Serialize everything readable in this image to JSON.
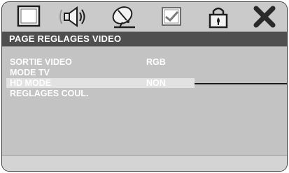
{
  "tabs": [
    {
      "icon": "tv-screen-icon",
      "selected": false
    },
    {
      "icon": "speaker-audio-icon",
      "selected": false
    },
    {
      "icon": "satellite-dish-icon",
      "selected": true
    },
    {
      "icon": "checkbox-preferences-icon",
      "selected": false
    },
    {
      "icon": "padlock-icon",
      "selected": false
    },
    {
      "icon": "close-x-icon",
      "selected": false
    }
  ],
  "title": "PAGE REGLAGES VIDEO",
  "menu": [
    {
      "label": "SORTIE VIDEO",
      "value": "RGB"
    },
    {
      "label": "MODE TV",
      "value": ""
    },
    {
      "label": "HD MODE",
      "value": "NON"
    },
    {
      "label": "REGLAGES COUL.",
      "value": ""
    }
  ],
  "colors": {
    "title_bar": "#4f4f4f",
    "panel": "#c3c3c3",
    "highlight": "#e2e2e2",
    "text": "#ffffff"
  }
}
